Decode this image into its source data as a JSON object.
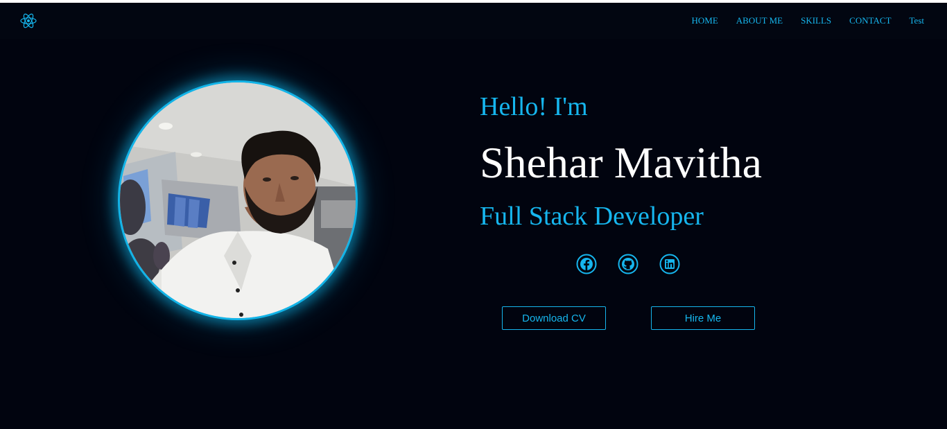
{
  "navbar": {
    "logo_icon": "react-atom-icon",
    "links": [
      {
        "label": "HOME"
      },
      {
        "label": "ABOUT ME"
      },
      {
        "label": "SKILLS"
      },
      {
        "label": "CONTACT"
      },
      {
        "label": "Test"
      }
    ]
  },
  "hero": {
    "greeting": "Hello! I'm",
    "name": "Shehar Mavitha",
    "role": "Full Stack Developer",
    "socials": [
      {
        "icon": "facebook-icon"
      },
      {
        "icon": "github-icon"
      },
      {
        "icon": "linkedin-icon"
      }
    ],
    "buttons": {
      "download_cv": "Download CV",
      "hire_me": "Hire Me"
    }
  },
  "colors": {
    "background": "#01040f",
    "accent": "#16b6ee",
    "text": "#ffffff"
  }
}
